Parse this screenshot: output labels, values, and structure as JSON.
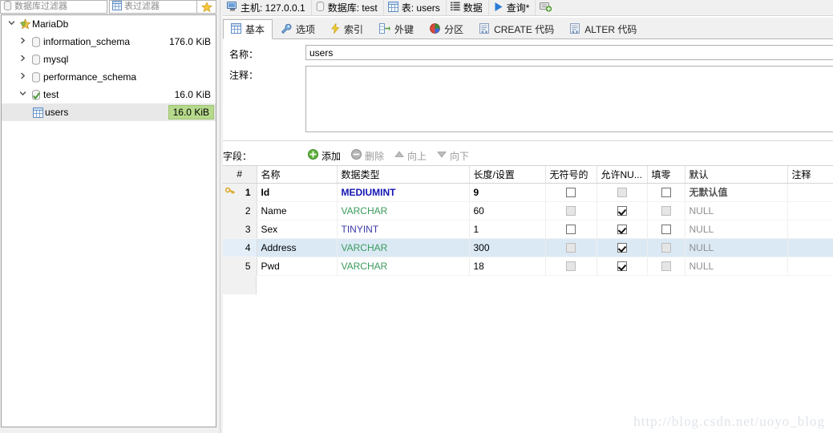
{
  "sidebar": {
    "filters": [
      {
        "name": "database-filter",
        "placeholder": "数据库过滤器",
        "value": "",
        "icon": "database-icon"
      },
      {
        "name": "table-filter",
        "placeholder": "表过滤器",
        "value": "",
        "icon": "table-icon"
      }
    ],
    "favorite_icon": "star-icon",
    "tree": [
      {
        "label": "MariaDb",
        "size": "",
        "depth": 0,
        "expanded": true,
        "icon": "server-icon",
        "selected": false
      },
      {
        "label": "information_schema",
        "size": "176.0 KiB",
        "depth": 1,
        "expanded": false,
        "icon": "database-icon",
        "selected": false
      },
      {
        "label": "mysql",
        "size": "",
        "depth": 1,
        "expanded": false,
        "icon": "database-icon",
        "selected": false
      },
      {
        "label": "performance_schema",
        "size": "",
        "depth": 1,
        "expanded": false,
        "icon": "database-icon",
        "selected": false
      },
      {
        "label": "test",
        "size": "16.0 KiB",
        "depth": 1,
        "expanded": true,
        "icon": "database-active-icon",
        "selected": false
      },
      {
        "label": "users",
        "size": "16.0 KiB",
        "depth": 2,
        "expanded": null,
        "icon": "table-icon",
        "selected": true,
        "size_highlight": true
      }
    ]
  },
  "toolbar": {
    "items": [
      {
        "name": "host",
        "label": "主机: 127.0.0.1",
        "icon": "host-icon"
      },
      {
        "name": "database",
        "label": "数据库: test",
        "icon": "database-icon"
      },
      {
        "name": "table",
        "label": "表: users",
        "icon": "table-icon"
      },
      {
        "name": "data",
        "label": "数据",
        "icon": "data-grid-icon"
      },
      {
        "name": "query",
        "label": "查询*",
        "icon": "play-icon"
      },
      {
        "name": "new-query",
        "label": "",
        "icon": "new-query-icon"
      }
    ]
  },
  "tabs": [
    {
      "name": "basic",
      "label": "基本",
      "icon": "table-icon",
      "active": true
    },
    {
      "name": "options",
      "label": "选项",
      "icon": "wrench-icon",
      "active": false
    },
    {
      "name": "indexes",
      "label": "索引",
      "icon": "lightning-icon",
      "active": false
    },
    {
      "name": "foreign-keys",
      "label": "外键",
      "icon": "foreign-key-icon",
      "active": false
    },
    {
      "name": "partitions",
      "label": "分区",
      "icon": "pie-icon",
      "active": false
    },
    {
      "name": "create-code",
      "label": "CREATE 代码",
      "icon": "code-icon",
      "active": false
    },
    {
      "name": "alter-code",
      "label": "ALTER 代码",
      "icon": "code-icon",
      "active": false
    }
  ],
  "form": {
    "name_label": "名称：",
    "name_value": "users",
    "name_placeholder": "",
    "comment_label": "注释：",
    "comment_value": "",
    "comment_placeholder": ""
  },
  "fields_toolbar": {
    "label": "字段：",
    "buttons": [
      {
        "name": "add-field",
        "label": "添加",
        "icon": "plus-circle-icon",
        "enabled": true
      },
      {
        "name": "remove-field",
        "label": "删除",
        "icon": "minus-circle-icon",
        "enabled": false
      },
      {
        "name": "move-up",
        "label": "向上",
        "icon": "triangle-up-icon",
        "enabled": false
      },
      {
        "name": "move-down",
        "label": "向下",
        "icon": "triangle-down-icon",
        "enabled": false
      }
    ]
  },
  "grid": {
    "columns": [
      {
        "key": "num",
        "label": "#"
      },
      {
        "key": "name",
        "label": "名称"
      },
      {
        "key": "datatype",
        "label": "数据类型"
      },
      {
        "key": "length",
        "label": "长度/设置"
      },
      {
        "key": "unsigned",
        "label": "无符号的"
      },
      {
        "key": "allow_null",
        "label": "允许NU..."
      },
      {
        "key": "zerofill",
        "label": "填零"
      },
      {
        "key": "default",
        "label": "默认"
      },
      {
        "key": "comment",
        "label": "注释"
      }
    ],
    "rows": [
      {
        "num": "1",
        "name": "Id",
        "datatype": "MEDIUMINT",
        "datatype_style": "int",
        "length": "9",
        "unsigned": {
          "checked": false,
          "disabled": false
        },
        "allow_null": {
          "checked": false,
          "disabled": true
        },
        "zerofill": {
          "checked": false,
          "disabled": false
        },
        "default": "无默认值",
        "default_style": "value",
        "comment": "",
        "primary_key": true,
        "selected": false
      },
      {
        "num": "2",
        "name": "Name",
        "datatype": "VARCHAR",
        "datatype_style": "varchar",
        "length": "60",
        "unsigned": {
          "checked": false,
          "disabled": true
        },
        "allow_null": {
          "checked": true,
          "disabled": false
        },
        "zerofill": {
          "checked": false,
          "disabled": true
        },
        "default": "NULL",
        "default_style": "null",
        "comment": "",
        "primary_key": false,
        "selected": false
      },
      {
        "num": "3",
        "name": "Sex",
        "datatype": "TINYINT",
        "datatype_style": "tinyint",
        "length": "1",
        "unsigned": {
          "checked": false,
          "disabled": false
        },
        "allow_null": {
          "checked": true,
          "disabled": false
        },
        "zerofill": {
          "checked": false,
          "disabled": false
        },
        "default": "NULL",
        "default_style": "null",
        "comment": "",
        "primary_key": false,
        "selected": false
      },
      {
        "num": "4",
        "name": "Address",
        "datatype": "VARCHAR",
        "datatype_style": "varchar",
        "length": "300",
        "unsigned": {
          "checked": false,
          "disabled": true
        },
        "allow_null": {
          "checked": true,
          "disabled": false
        },
        "zerofill": {
          "checked": false,
          "disabled": true
        },
        "default": "NULL",
        "default_style": "null",
        "comment": "",
        "primary_key": false,
        "selected": true
      },
      {
        "num": "5",
        "name": "Pwd",
        "datatype": "VARCHAR",
        "datatype_style": "varchar",
        "length": "18",
        "unsigned": {
          "checked": false,
          "disabled": true
        },
        "allow_null": {
          "checked": true,
          "disabled": false
        },
        "zerofill": {
          "checked": false,
          "disabled": true
        },
        "default": "NULL",
        "default_style": "null",
        "comment": "",
        "primary_key": false,
        "selected": false
      }
    ]
  },
  "watermark": {
    "text": "http://blog.csdn.net/uoyo_blog"
  },
  "colors": {
    "selection_blue": "#dbe9f5",
    "size_badge_green": "#b6d98c",
    "int_type": "#1414b4",
    "varchar_type": "#3a9a5c",
    "chrome_gray": "#f0f0f0"
  }
}
